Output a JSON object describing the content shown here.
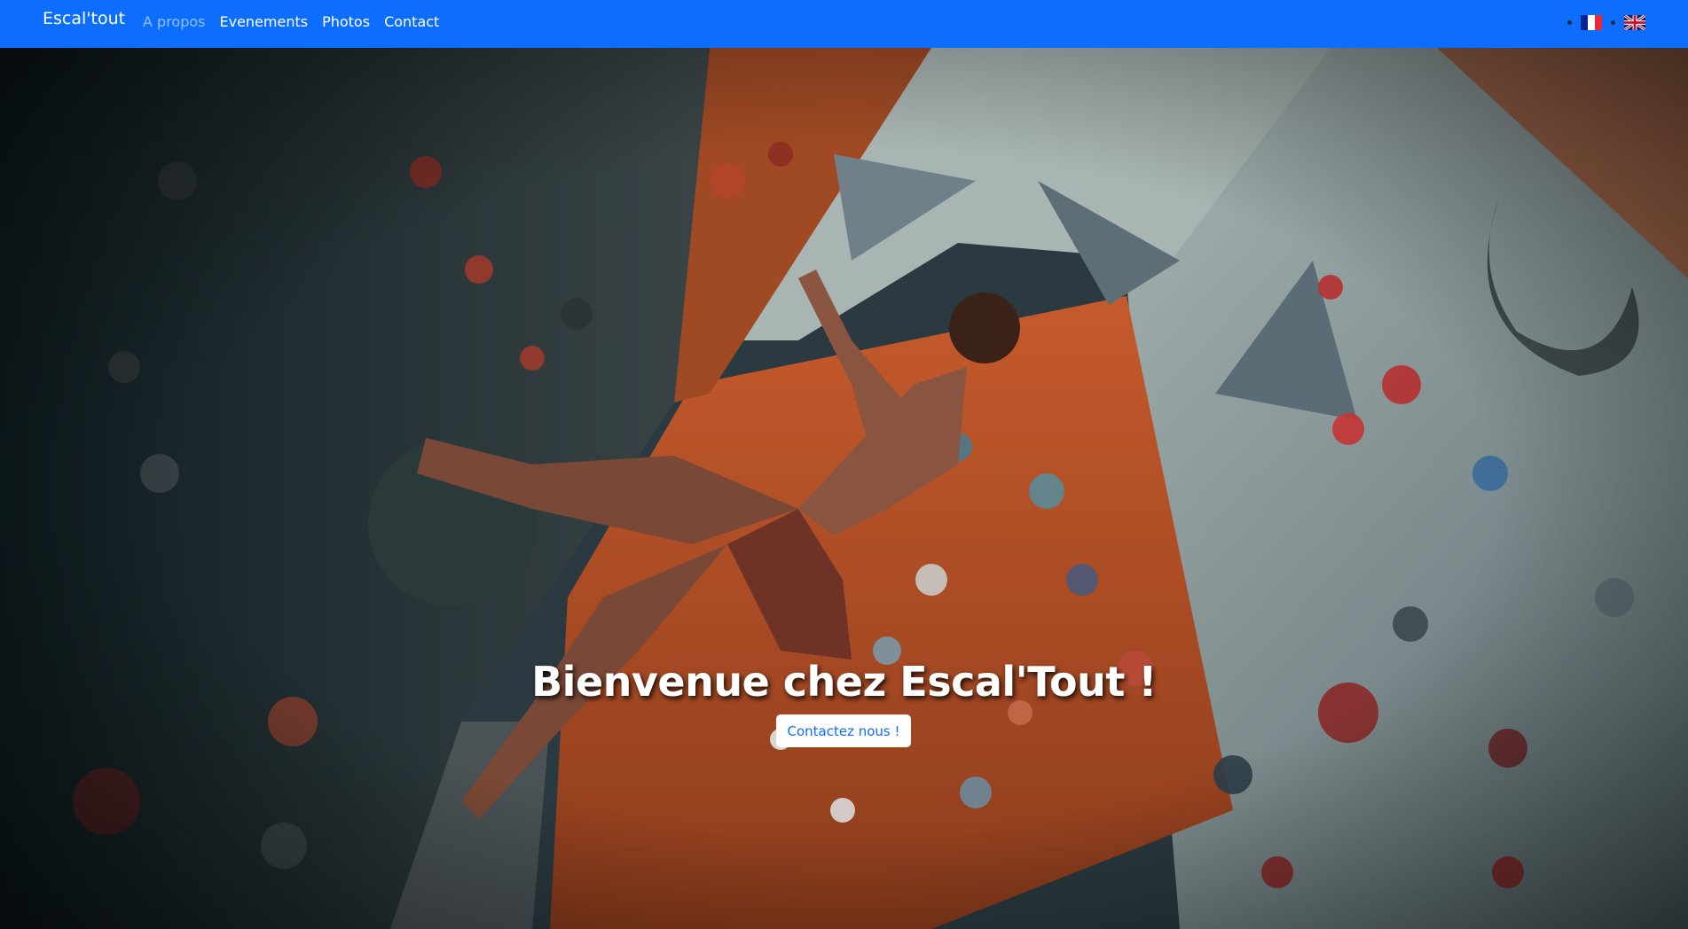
{
  "nav": {
    "brand": "Escal'tout",
    "links": [
      {
        "label": "A propos",
        "active": true
      },
      {
        "label": "Evenements",
        "active": false
      },
      {
        "label": "Photos",
        "active": false
      },
      {
        "label": "Contact",
        "active": false
      }
    ],
    "languages": [
      {
        "code": "fr",
        "icon": "french-flag-icon"
      },
      {
        "code": "en",
        "icon": "uk-flag-icon"
      }
    ],
    "accent_color": "#0d6efd"
  },
  "hero": {
    "title": "Bienvenue chez Escal'Tout !",
    "button_label": "Contactez nous !"
  }
}
